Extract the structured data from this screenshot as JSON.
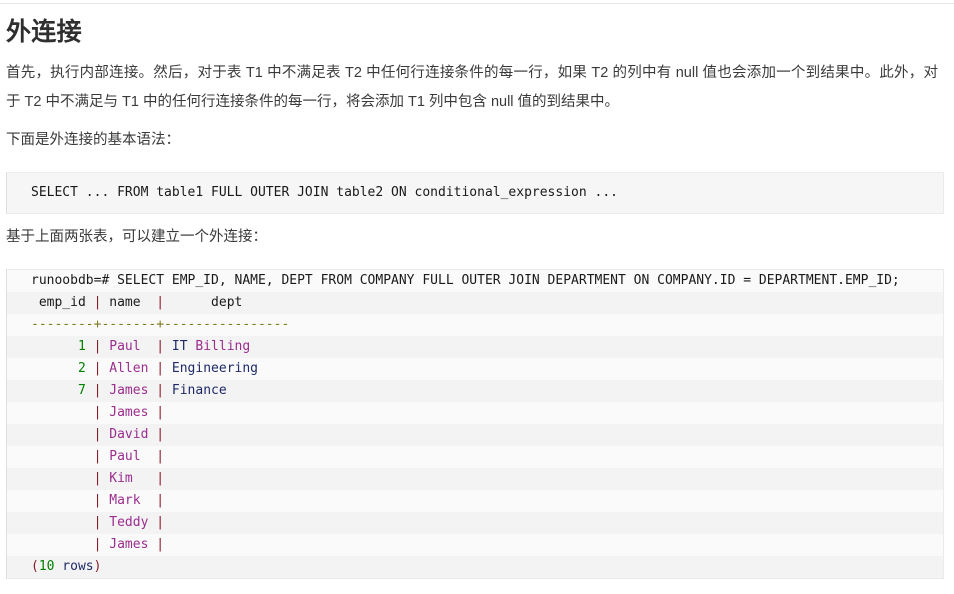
{
  "page": {
    "heading": "外连接",
    "paragraphs": [
      "首先，执行内部连接。然后，对于表 T1 中不满足表 T2 中任何行连接条件的每一行，如果 T2 的列中有 null 值也会添加一个到结果中。此外，对于 T2 中不满足与 T1 中的任何行连接条件的每一行，将会添加 T1 列中包含 null 值的到结果中。",
      "下面是外连接的基本语法：",
      "基于上面两张表，可以建立一个外连接："
    ]
  },
  "syntax_block": {
    "line": "SELECT ... FROM table1 FULL OUTER JOIN table2 ON conditional_expression ..."
  },
  "output_block": {
    "command": "runoobdb=# SELECT EMP_ID, NAME, DEPT FROM COMPANY FULL OUTER JOIN DEPARTMENT ON COMPANY.ID = DEPARTMENT.EMP_ID;",
    "header": " emp_id | name  |      dept",
    "separator": "--------+-------+----------------",
    "rows": [
      {
        "emp_id": "      1",
        "name": "Paul ",
        "dept_first": "IT",
        "dept_rest": " Billing"
      },
      {
        "emp_id": "      2",
        "name": "Allen",
        "dept_first": "Engineering",
        "dept_rest": ""
      },
      {
        "emp_id": "      7",
        "name": "James",
        "dept_first": "Finance",
        "dept_rest": ""
      },
      {
        "emp_id": "       ",
        "name": "James",
        "dept_first": "",
        "dept_rest": ""
      },
      {
        "emp_id": "       ",
        "name": "David",
        "dept_first": "",
        "dept_rest": ""
      },
      {
        "emp_id": "       ",
        "name": "Paul ",
        "dept_first": "",
        "dept_rest": ""
      },
      {
        "emp_id": "       ",
        "name": "Kim  ",
        "dept_first": "",
        "dept_rest": ""
      },
      {
        "emp_id": "       ",
        "name": "Mark ",
        "dept_first": "",
        "dept_rest": ""
      },
      {
        "emp_id": "       ",
        "name": "Teddy",
        "dept_first": "",
        "dept_rest": ""
      },
      {
        "emp_id": "       ",
        "name": "James",
        "dept_first": "",
        "dept_rest": ""
      }
    ],
    "footer": {
      "open": "(",
      "count": "10",
      "label": " rows",
      "close": ")"
    }
  },
  "colors": {
    "number": "#008000",
    "pipe": "#8b1a2b",
    "name": "#9b2d8f",
    "dept": "#9b2d8f",
    "dept_first": "#1f2a66",
    "dash": "#7c7a1e",
    "plain": "#1a1a1a",
    "block_bg": "#f6f6f6",
    "stripe_a": "#fafafa",
    "stripe_b": "#f3f3f3"
  }
}
